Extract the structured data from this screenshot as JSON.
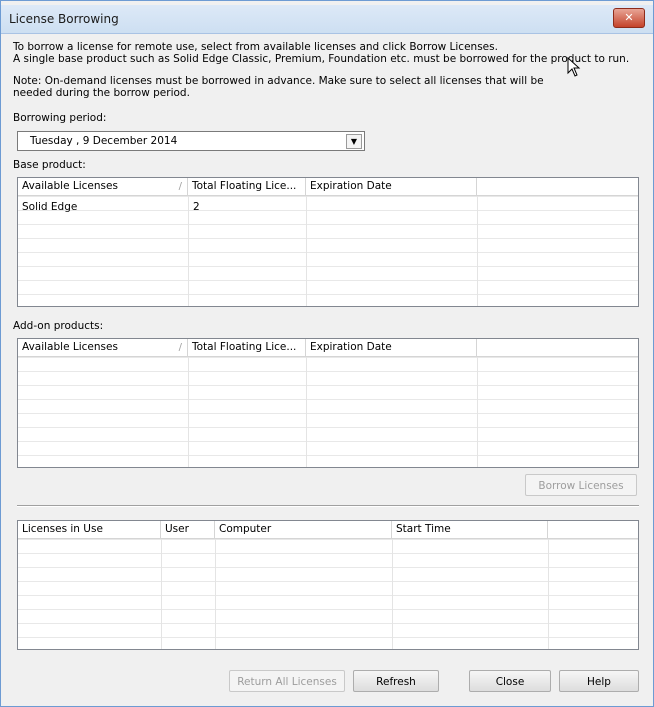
{
  "window": {
    "title": "License Borrowing",
    "close_glyph": "✕"
  },
  "intro": {
    "line1": "To borrow a license for remote use, select from available licenses and click Borrow Licenses.",
    "line2": "A single base product such as Solid Edge Classic, Premium, Foundation etc. must be borrowed for the product to run.",
    "note1": "Note: On-demand licenses must be borrowed in advance.  Make sure to select all licenses that will be",
    "note2": "needed during the borrow period."
  },
  "borrowing_period": {
    "label": "Borrowing period:",
    "value": "Tuesday   ,   9 December  2014",
    "arrow": "▼"
  },
  "base_product": {
    "label": "Base product:",
    "columns": [
      "Available Licenses",
      "Total Floating Lice...",
      "Expiration Date",
      ""
    ],
    "sort_indicator": "/",
    "rows": [
      {
        "name": "Solid Edge",
        "total": "2",
        "expiration": ""
      }
    ]
  },
  "addon_products": {
    "label": "Add-on products:",
    "columns": [
      "Available Licenses",
      "Total Floating Lice...",
      "Expiration Date",
      ""
    ],
    "sort_indicator": "/",
    "rows": []
  },
  "borrow_button": "Borrow Licenses",
  "in_use": {
    "columns": [
      "Licenses in Use",
      "User",
      "Computer",
      "Start Time",
      ""
    ],
    "rows": []
  },
  "buttons": {
    "return_all": "Return All Licenses",
    "refresh": "Refresh",
    "close": "Close",
    "help": "Help"
  },
  "colors": {
    "title_bg": "#cddff2",
    "close_red": "#c4422a",
    "dialog_bg": "#f0f0f0"
  }
}
